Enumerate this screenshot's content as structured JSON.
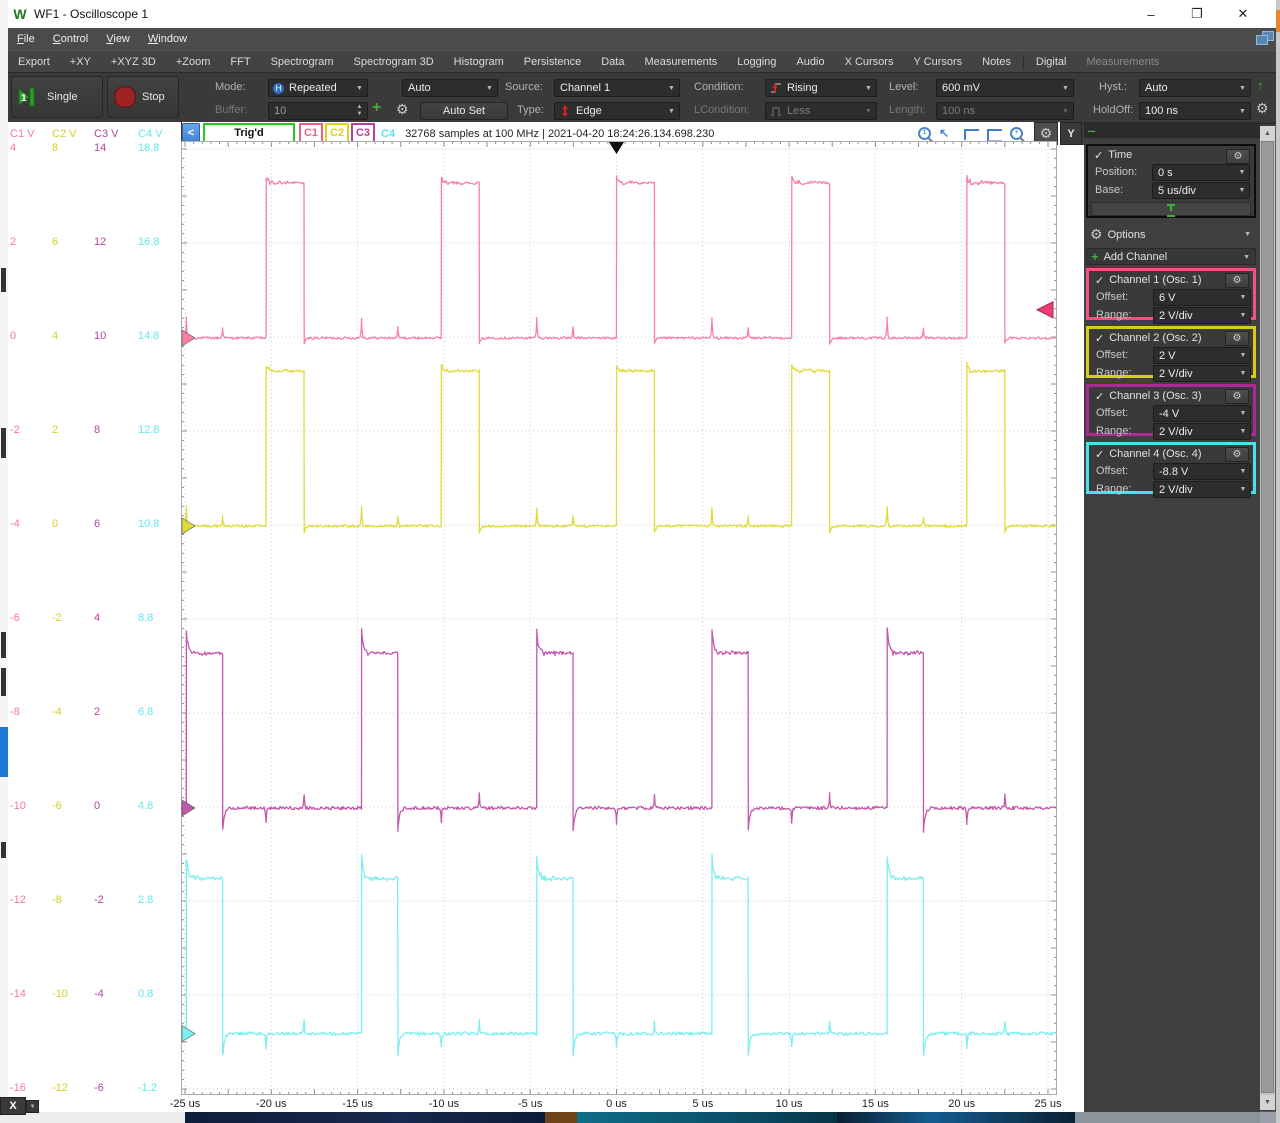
{
  "window": {
    "title": "WF1 - Oscilloscope 1",
    "logo": "W",
    "controls": {
      "minimize": "–",
      "maximize": "❐",
      "close": "✕"
    }
  },
  "menubar": {
    "items": [
      "File",
      "Control",
      "View",
      "Window"
    ]
  },
  "viewbar": {
    "items": [
      "Export",
      "+XY",
      "+XYZ 3D",
      "+Zoom",
      "FFT",
      "Spectrogram",
      "Spectrogram 3D",
      "Histogram",
      "Persistence",
      "Data",
      "Measurements",
      "Logging",
      "Audio",
      "X Cursors",
      "Y Cursors",
      "Notes",
      "Digital"
    ],
    "disabled_item": "Measurements"
  },
  "run_controls": {
    "single": "Single",
    "stop": "Stop"
  },
  "trigger": {
    "mode_label": "Mode:",
    "mode": "Repeated",
    "auto": "Auto",
    "source_label": "Source:",
    "source": "Channel 1",
    "condition_label": "Condition:",
    "condition": "Rising",
    "level_label": "Level:",
    "level": "600 mV",
    "hyst_label": "Hyst.:",
    "hyst": "Auto",
    "buffer_label": "Buffer:",
    "buffer": "10",
    "autoset": "Auto Set",
    "type_label": "Type:",
    "type": "Edge",
    "lcondition_label": "LCondition:",
    "lcondition": "Less",
    "length_label": "Length:",
    "length": "100 ns",
    "holdoff_label": "HoldOff:",
    "holdoff": "100 ns"
  },
  "status": {
    "back": "<",
    "trigd": "Trig'd",
    "channel_tags": [
      {
        "label": "C1",
        "color": "#f25f87",
        "boxed": true
      },
      {
        "label": "C2",
        "color": "#ddd41e",
        "boxed": true
      },
      {
        "label": "C3",
        "color": "#b43fa0",
        "boxed": true
      },
      {
        "label": "C4",
        "color": "#55e6ee",
        "boxed": false
      }
    ],
    "samples": "32768 samples at 100 MHz | 2021-04-20 18:24:26.134.698.230",
    "y_button": "Y"
  },
  "right_panel": {
    "time": {
      "title": "Time",
      "position_label": "Position:",
      "position": "0 s",
      "base_label": "Base:",
      "base": "5 us/div"
    },
    "options": "Options",
    "add_channel": "Add Channel",
    "channels": [
      {
        "title": "Channel 1 (Osc. 1)",
        "offset_label": "Offset:",
        "offset": "6 V",
        "range_label": "Range:",
        "range": "2 V/div",
        "color": "#f2527d"
      },
      {
        "title": "Channel 2 (Osc. 2)",
        "offset_label": "Offset:",
        "offset": "2 V",
        "range_label": "Range:",
        "range": "2 V/div",
        "color": "#d6cc16"
      },
      {
        "title": "Channel 3 (Osc. 3)",
        "offset_label": "Offset:",
        "offset": "-4 V",
        "range_label": "Range:",
        "range": "2 V/div",
        "color": "#a82c92"
      },
      {
        "title": "Channel 4 (Osc. 4)",
        "offset_label": "Offset:",
        "offset": "-8.8 V",
        "range_label": "Range:",
        "range": "2 V/div",
        "color": "#49e2ec"
      }
    ]
  },
  "axis": {
    "x_ticks": [
      "-25 us",
      "-20 us",
      "-15 us",
      "-10 us",
      "-5 us",
      "0 us",
      "5 us",
      "10 us",
      "15 us",
      "20 us",
      "25 us"
    ],
    "left_headers": [
      {
        "label": "C1 V",
        "color": "#f9759d"
      },
      {
        "label": "C2 V",
        "color": "#d8d020"
      },
      {
        "label": "C3 V",
        "color": "#bb3ea3"
      },
      {
        "label": "C4 V",
        "color": "#5fe7ef"
      }
    ],
    "left_rows": [
      [
        "4",
        "8",
        "14",
        "18.8"
      ],
      [
        "2",
        "6",
        "12",
        "16.8"
      ],
      [
        "0",
        "4",
        "10",
        "14.8"
      ],
      [
        "-2",
        "2",
        "8",
        "12.8"
      ],
      [
        "-4",
        "0",
        "6",
        "10.8"
      ],
      [
        "-6",
        "-2",
        "4",
        "8.8"
      ],
      [
        "-8",
        "-4",
        "2",
        "6.8"
      ],
      [
        "-10",
        "-6",
        "0",
        "4.8"
      ],
      [
        "-12",
        "-8",
        "-2",
        "2.8"
      ],
      [
        "-14",
        "-10",
        "-4",
        "0.8"
      ],
      [
        "-16",
        "-12",
        "-6",
        "-1.2"
      ]
    ]
  },
  "bottom": {
    "x_button": "X"
  },
  "chart_data": {
    "type": "line",
    "title": "Oscilloscope time-domain capture: four 3.3 V square waves",
    "x_axis": {
      "unit": "us",
      "min": -25,
      "max": 25,
      "divisions": 10,
      "per_div": "5 us/div"
    },
    "trigger": {
      "source": "Channel 1",
      "condition": "Rising",
      "level_V": 0.6,
      "position_us": 0
    },
    "channels": [
      {
        "name": "Channel 1",
        "trace_color": "#f97fa3",
        "offset_V": 6,
        "range_V_per_div": 2,
        "low_V": 0,
        "high_V": 3.3,
        "period_us": 10.15,
        "pulse_width_us": 2.2,
        "rising_edges_us": [
          -20.3,
          -10.15,
          0,
          10.15,
          20.3
        ]
      },
      {
        "name": "Channel 2",
        "trace_color": "#e2da36",
        "offset_V": 2,
        "range_V_per_div": 2,
        "low_V": 0,
        "high_V": 3.3,
        "period_us": 10.15,
        "pulse_width_us": 2.2,
        "rising_edges_us": [
          -20.3,
          -10.15,
          0,
          10.15,
          20.3
        ]
      },
      {
        "name": "Channel 3",
        "trace_color": "#c257ab",
        "offset_V": -4,
        "range_V_per_div": 2,
        "low_V": 0,
        "high_V": 3.3,
        "period_us": 10.15,
        "pulse_width_us": 2.1,
        "rising_edges_us": [
          -24.92,
          -14.77,
          -4.62,
          5.53,
          15.68
        ]
      },
      {
        "name": "Channel 4",
        "trace_color": "#7deef2",
        "offset_V": -8.8,
        "range_V_per_div": 2,
        "low_V": 0,
        "high_V": 3.3,
        "period_us": 10.15,
        "pulse_width_us": 2.1,
        "rising_edges_us": [
          -24.92,
          -14.77,
          -4.62,
          5.53,
          15.68
        ]
      }
    ]
  }
}
